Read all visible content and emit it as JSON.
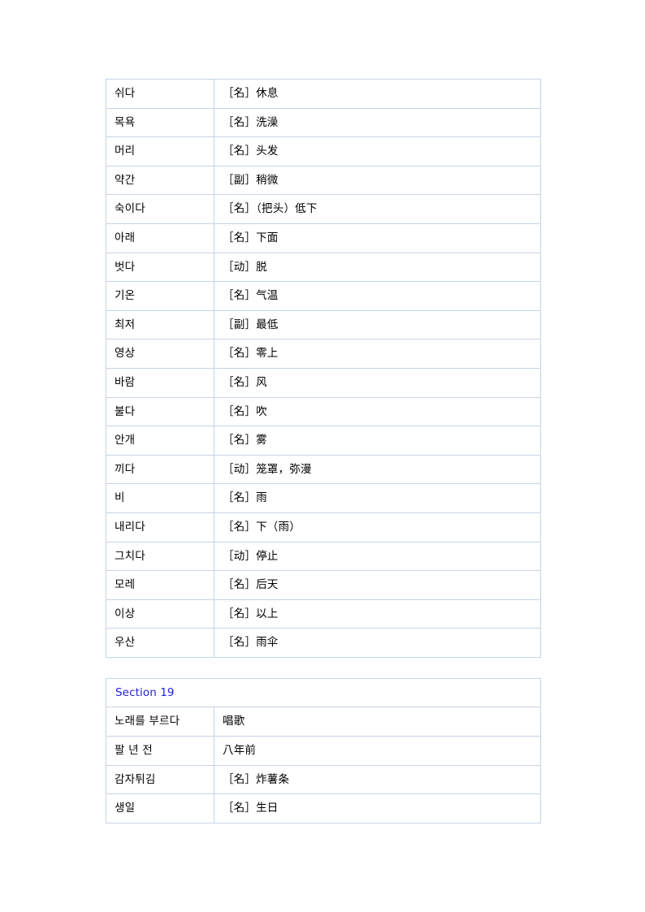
{
  "document": {
    "background_color": "#ffffff",
    "border_color": "#c6d4e5",
    "text_color": "#000000",
    "accent_color": "#2222dd"
  },
  "tables": [
    {
      "name": "vocabulary-table-1",
      "has_section_header": false,
      "rows": [
        {
          "term": "쉬다",
          "gloss": "［名］休息"
        },
        {
          "term": "목욕",
          "gloss": "［名］洗澡"
        },
        {
          "term": "머리",
          "gloss": "［名］头发"
        },
        {
          "term": "약간",
          "gloss": "［副］稍微"
        },
        {
          "term": "숙이다",
          "gloss": "［名］（把头）低下"
        },
        {
          "term": "아래",
          "gloss": "［名］下面"
        },
        {
          "term": "벗다",
          "gloss": "［动］脱"
        },
        {
          "term": "기온",
          "gloss": "［名］气温"
        },
        {
          "term": "최저",
          "gloss": "［副］最低"
        },
        {
          "term": "영상",
          "gloss": "［名］零上"
        },
        {
          "term": "바람",
          "gloss": "［名］风"
        },
        {
          "term": "불다",
          "gloss": "［名］吹"
        },
        {
          "term": "안개",
          "gloss": "［名］雾"
        },
        {
          "term": "끼다",
          "gloss": "［动］笼罩，弥漫"
        },
        {
          "term": "비",
          "gloss": "［名］雨"
        },
        {
          "term": "내리다",
          "gloss": "［名］下（雨）"
        },
        {
          "term": "그치다",
          "gloss": "［动］停止"
        },
        {
          "term": "모레",
          "gloss": "［名］后天"
        },
        {
          "term": "이상",
          "gloss": "［名］以上"
        },
        {
          "term": "우산",
          "gloss": "［名］雨伞"
        }
      ]
    },
    {
      "name": "vocabulary-table-2",
      "has_section_header": true,
      "section_header": "Section 19",
      "rows": [
        {
          "term": "노래를 부르다",
          "gloss": "唱歌"
        },
        {
          "term": "팔 년 전",
          "gloss": "八年前"
        },
        {
          "term": "감자튀김",
          "gloss": "［名］炸薯条"
        },
        {
          "term": "생일",
          "gloss": "［名］生日"
        }
      ]
    }
  ]
}
